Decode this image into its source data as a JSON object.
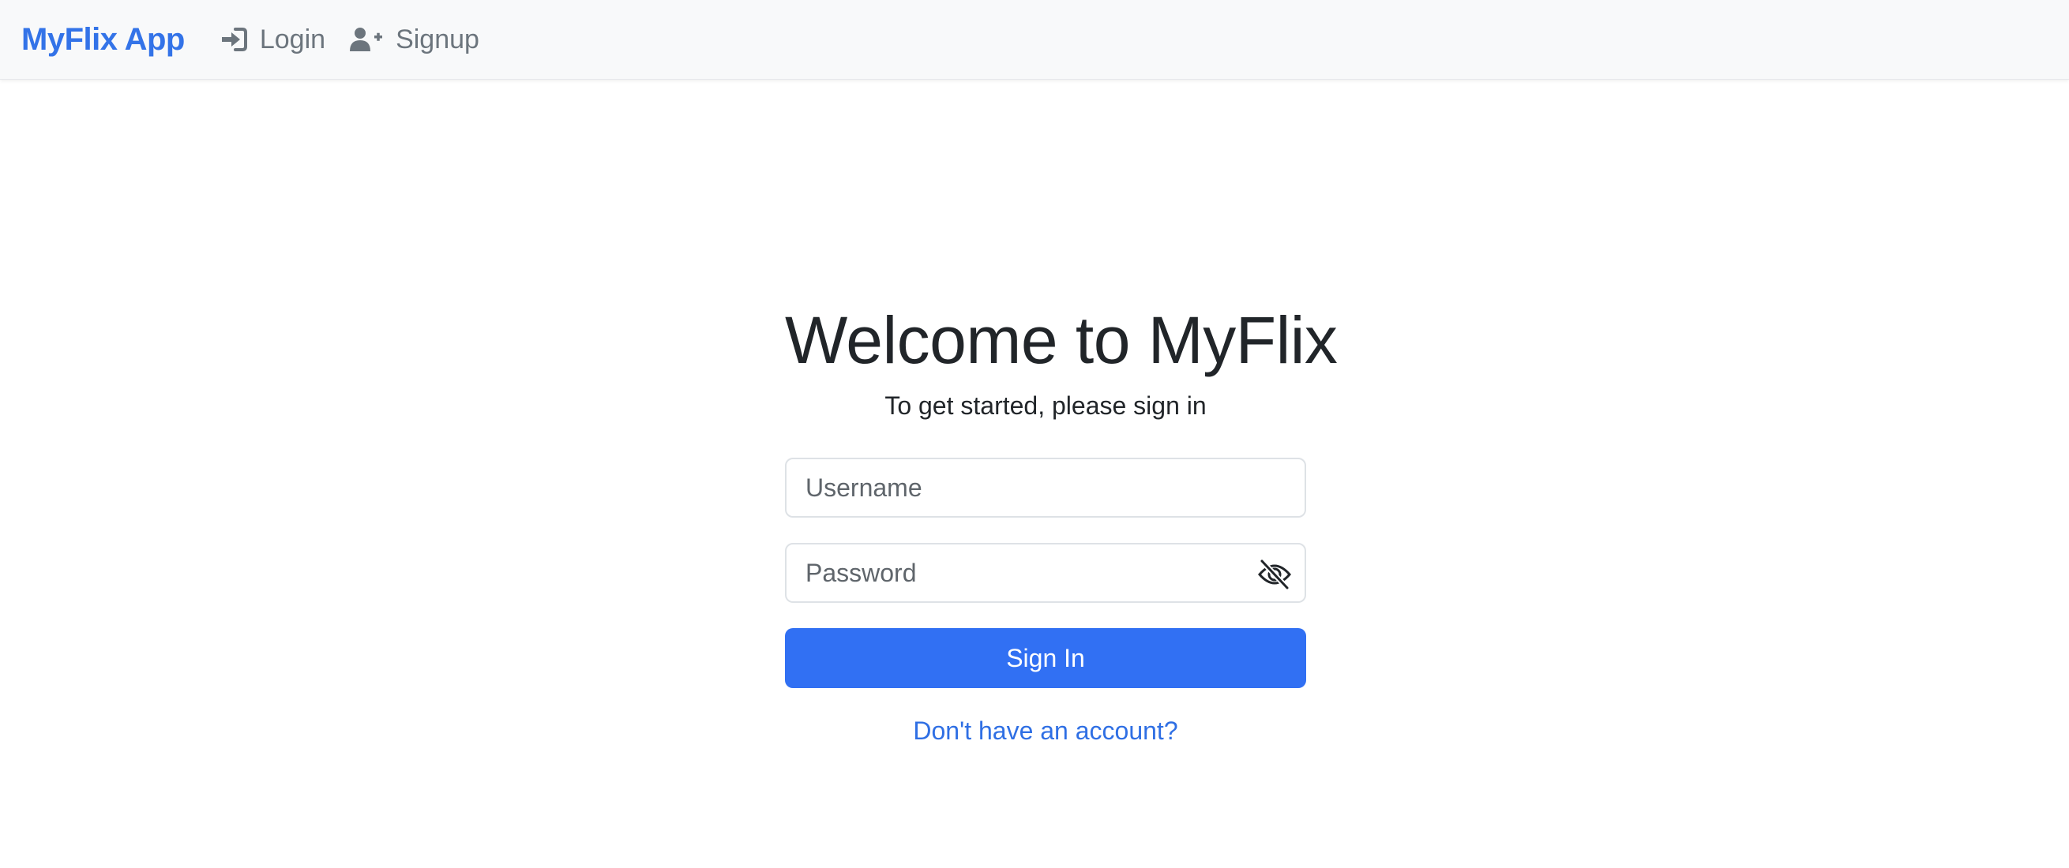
{
  "navbar": {
    "brand": "MyFlix App",
    "links": [
      {
        "label": "Login",
        "icon": "login-icon"
      },
      {
        "label": "Signup",
        "icon": "user-plus-icon"
      }
    ]
  },
  "main": {
    "title": "Welcome to MyFlix",
    "subtitle": "To get started, please sign in",
    "username_placeholder": "Username",
    "password_placeholder": "Password",
    "password_toggle_icon": "eye-slash-icon",
    "submit_label": "Sign In",
    "signup_link": "Don't have an account?"
  },
  "colors": {
    "brand": "#3373e8",
    "primary_button": "#3170f3",
    "link": "#2f6fe4",
    "navbar_bg": "#f8f9fa",
    "nav_text": "#6c757d"
  }
}
